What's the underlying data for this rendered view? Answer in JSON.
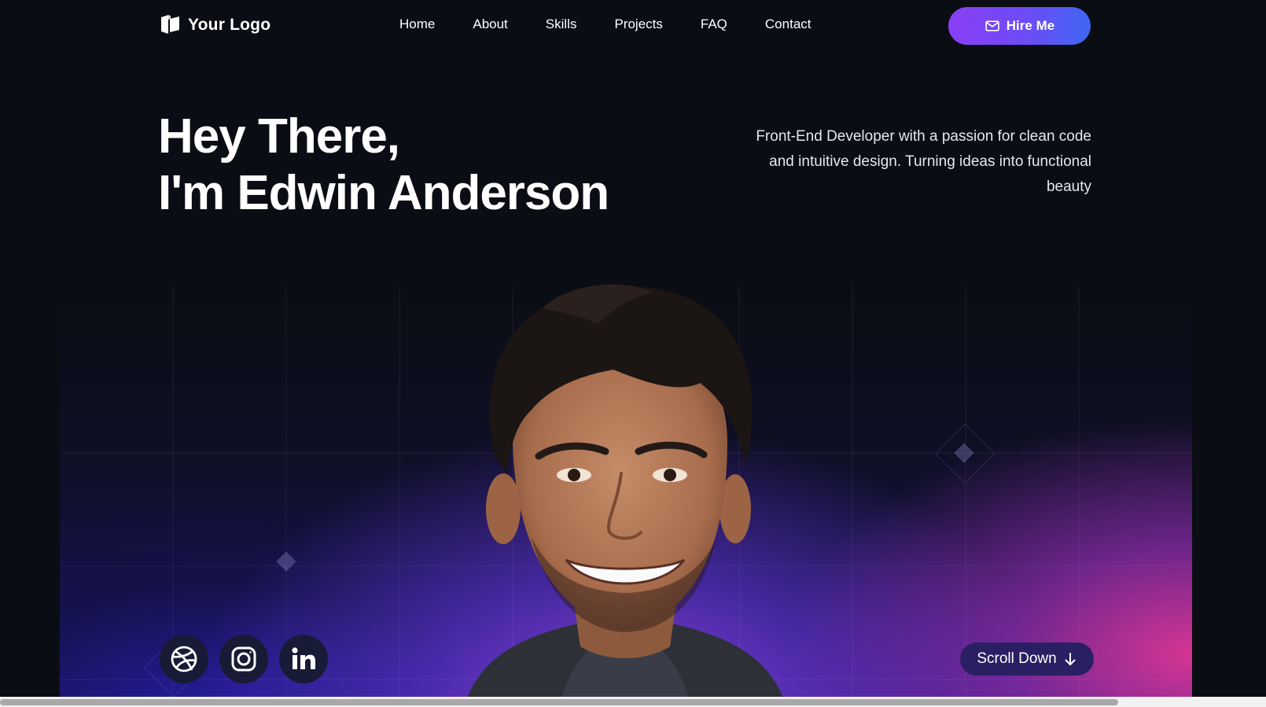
{
  "header": {
    "logo_text": "Your Logo",
    "nav": [
      "Home",
      "About",
      "Skills",
      "Projects",
      "FAQ",
      "Contact"
    ],
    "hire_label": "Hire Me"
  },
  "hero": {
    "title_line1": "Hey There,",
    "title_line2": "I'm Edwin Anderson",
    "description": "Front-End Developer with a passion for clean code and intuitive design. Turning ideas into functional beauty"
  },
  "socials": [
    "dribbble-icon",
    "instagram-icon",
    "linkedin-icon"
  ],
  "scroll_label": "Scroll Down",
  "colors": {
    "background": "#0b0d14",
    "accent_purple": "#8a3ff4",
    "accent_blue": "#3f66f2",
    "accent_pink": "#e03796"
  }
}
